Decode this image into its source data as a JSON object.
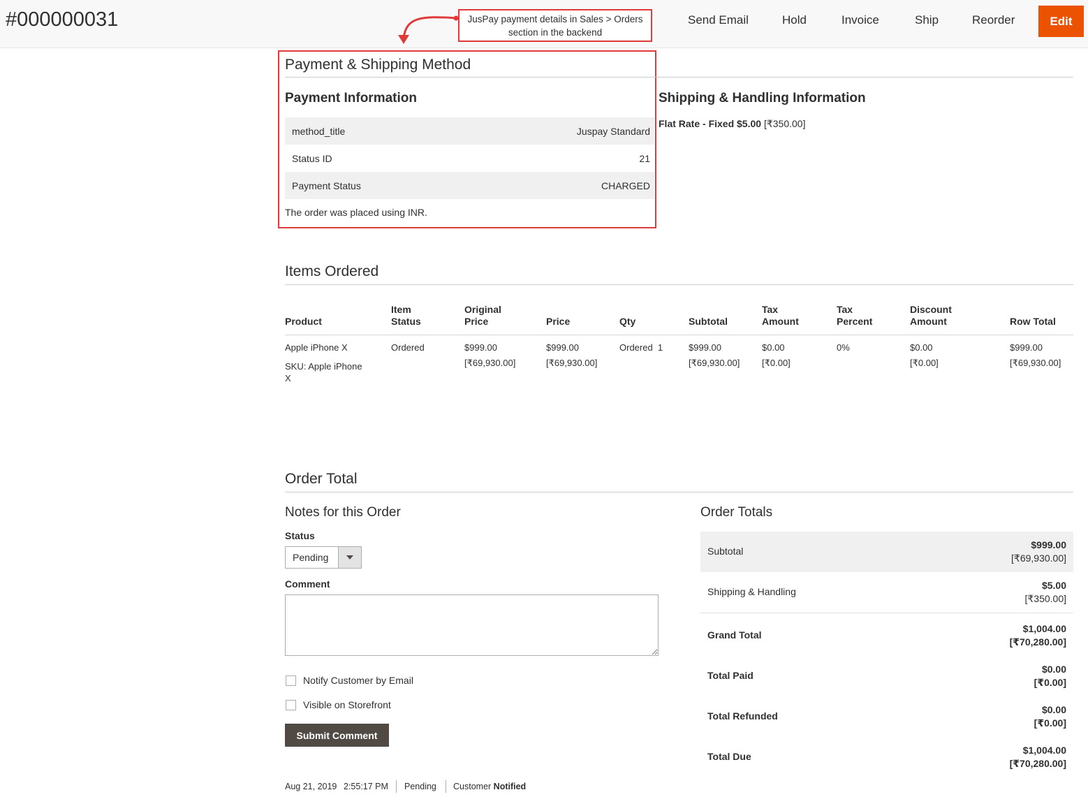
{
  "header": {
    "order_number": "#000000031",
    "buttons": {
      "send_email": "Send Email",
      "hold": "Hold",
      "invoice": "Invoice",
      "ship": "Ship",
      "reorder": "Reorder",
      "edit": "Edit"
    },
    "edit_color": "#eb5202"
  },
  "annotation": {
    "line1": "JusPay payment details in Sales > Orders",
    "line2": "section in the backend",
    "color": "#e03b3b"
  },
  "payment_shipping": {
    "title": "Payment & Shipping Method",
    "payment_info_title": "Payment Information",
    "rows": [
      {
        "label": "method_title",
        "value": "Juspay Standard"
      },
      {
        "label": "Status ID",
        "value": "21"
      },
      {
        "label": "Payment Status",
        "value": "CHARGED"
      }
    ],
    "currency_note": "The order was placed using INR.",
    "shipping_title": "Shipping & Handling Information",
    "shipping_method": "Flat Rate - Fixed $5.00",
    "shipping_converted": "[₹350.00]"
  },
  "items_ordered": {
    "title": "Items Ordered",
    "headers": {
      "product": "Product",
      "item_status_1": "Item",
      "item_status_2": "Status",
      "original_price_1": "Original",
      "original_price_2": "Price",
      "price": "Price",
      "qty": "Qty",
      "subtotal": "Subtotal",
      "tax_amount_1": "Tax",
      "tax_amount_2": "Amount",
      "tax_percent_1": "Tax",
      "tax_percent_2": "Percent",
      "discount_1": "Discount",
      "discount_2": "Amount",
      "row_total": "Row Total"
    },
    "rows": [
      {
        "product_name": "Apple iPhone X",
        "sku_line1": "SKU: Apple iPhone",
        "sku_line2": "X",
        "item_status": "Ordered",
        "original_price": "$999.00",
        "original_price_inr": "[₹69,930.00]",
        "price": "$999.00",
        "price_inr": "[₹69,930.00]",
        "qty": "Ordered  1",
        "subtotal": "$999.00",
        "subtotal_inr": "[₹69,930.00]",
        "tax_amount": "$0.00",
        "tax_amount_inr": "[₹0.00]",
        "tax_percent": "0%",
        "discount": "$0.00",
        "discount_inr": "[₹0.00]",
        "row_total": "$999.00",
        "row_total_inr": "[₹69,930.00]"
      }
    ]
  },
  "order_total": {
    "title": "Order Total",
    "notes": {
      "title": "Notes for this Order",
      "status_label": "Status",
      "status_value": "Pending",
      "comment_label": "Comment",
      "comment_value": "",
      "notify_label": "Notify Customer by Email",
      "visible_label": "Visible on Storefront",
      "submit_label": "Submit Comment",
      "history": {
        "date": "Aug 21, 2019",
        "time": "2:55:17 PM",
        "status": "Pending",
        "customer_prefix": "Customer",
        "customer_state": "Notified"
      }
    },
    "totals": {
      "title": "Order Totals",
      "rows": [
        {
          "label": "Subtotal",
          "usd": "$999.00",
          "inr": "[₹69,930.00]"
        },
        {
          "label": "Shipping & Handling",
          "usd": "$5.00",
          "inr": "[₹350.00]"
        },
        {
          "label": "Grand Total",
          "usd": "$1,004.00",
          "inr": "[₹70,280.00]"
        },
        {
          "label": "Total Paid",
          "usd": "$0.00",
          "inr": "[₹0.00]"
        },
        {
          "label": "Total Refunded",
          "usd": "$0.00",
          "inr": "[₹0.00]"
        },
        {
          "label": "Total Due",
          "usd": "$1,004.00",
          "inr": "[₹70,280.00]"
        }
      ]
    }
  }
}
